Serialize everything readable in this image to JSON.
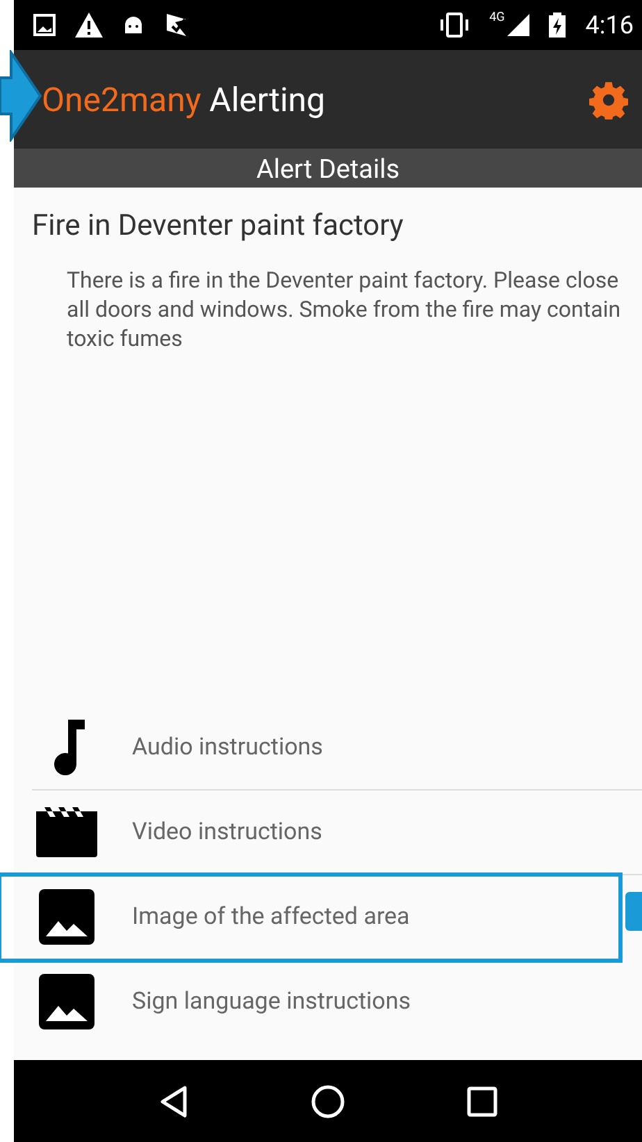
{
  "status_bar": {
    "time": "4:16",
    "network": "4G"
  },
  "app_bar": {
    "brand": "One2many",
    "title": "Alerting"
  },
  "subheader": "Alert Details",
  "alert": {
    "title": "Fire in Deventer paint factory",
    "message": "There is a fire in the Deventer paint factory. Please close all doors and windows. Smoke from the fire may contain toxic fumes"
  },
  "attachments": [
    {
      "kind": "audio",
      "label": "Audio instructions",
      "highlighted": false
    },
    {
      "kind": "video",
      "label": "Video instructions",
      "highlighted": false
    },
    {
      "kind": "image",
      "label": "Image of the affected area",
      "highlighted": true
    },
    {
      "kind": "image",
      "label": "Sign language instructions",
      "highlighted": false
    }
  ]
}
